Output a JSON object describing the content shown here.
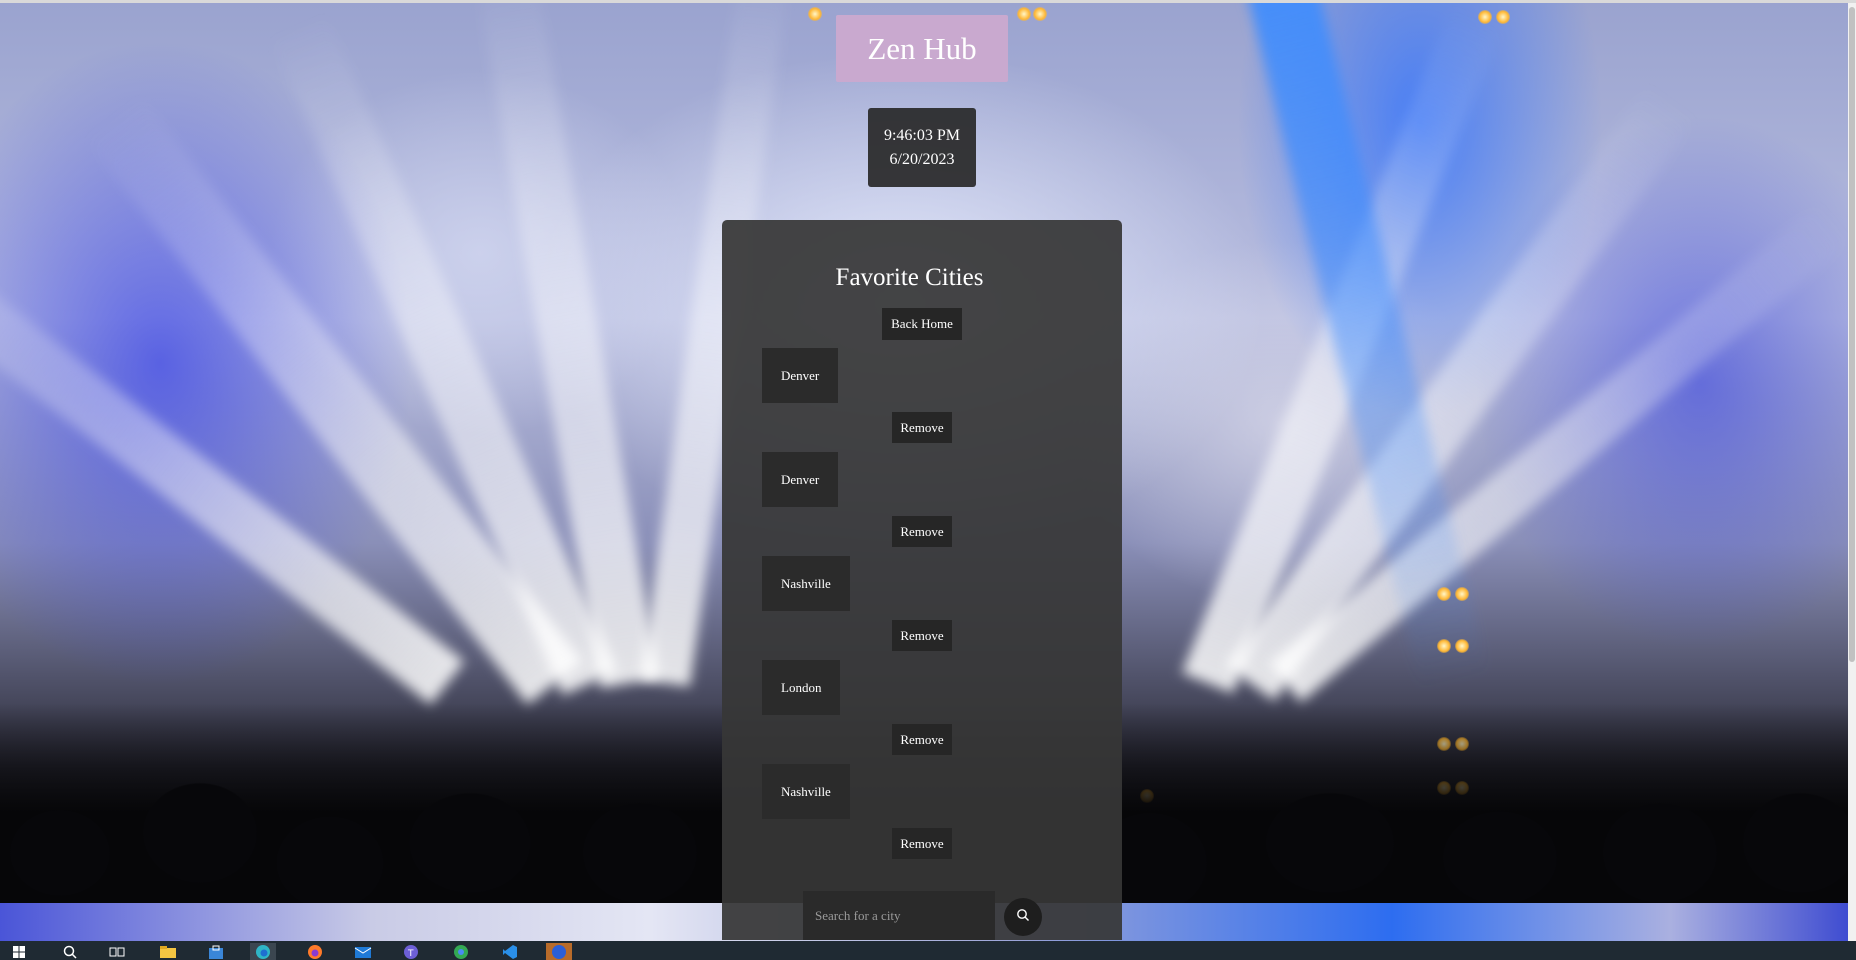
{
  "app": {
    "logo_text": "Zen Hub"
  },
  "clock": {
    "time": "9:46:03 PM",
    "date": "6/20/2023"
  },
  "favorites": {
    "title": "Favorite Cities",
    "back_home_label": "Back Home",
    "remove_label": "Remove",
    "cities": [
      "Denver",
      "Denver",
      "Nashville",
      "London",
      "Nashville"
    ]
  },
  "search": {
    "placeholder": "Search for a city",
    "value": ""
  },
  "taskbar": {
    "icons": [
      "windows-start-icon",
      "search-icon",
      "task-view-icon",
      "file-explorer-icon",
      "store-icon",
      "edge-browser-icon",
      "firefox-icon",
      "mail-icon",
      "teams-icon",
      "chrome-icon",
      "vscode-icon",
      "app-icon"
    ]
  },
  "colors": {
    "logo_bg": "#c9a9cf",
    "panel_bg": "#373737",
    "button_bg": "#262626",
    "taskbar_bg": "#1f2a33"
  }
}
